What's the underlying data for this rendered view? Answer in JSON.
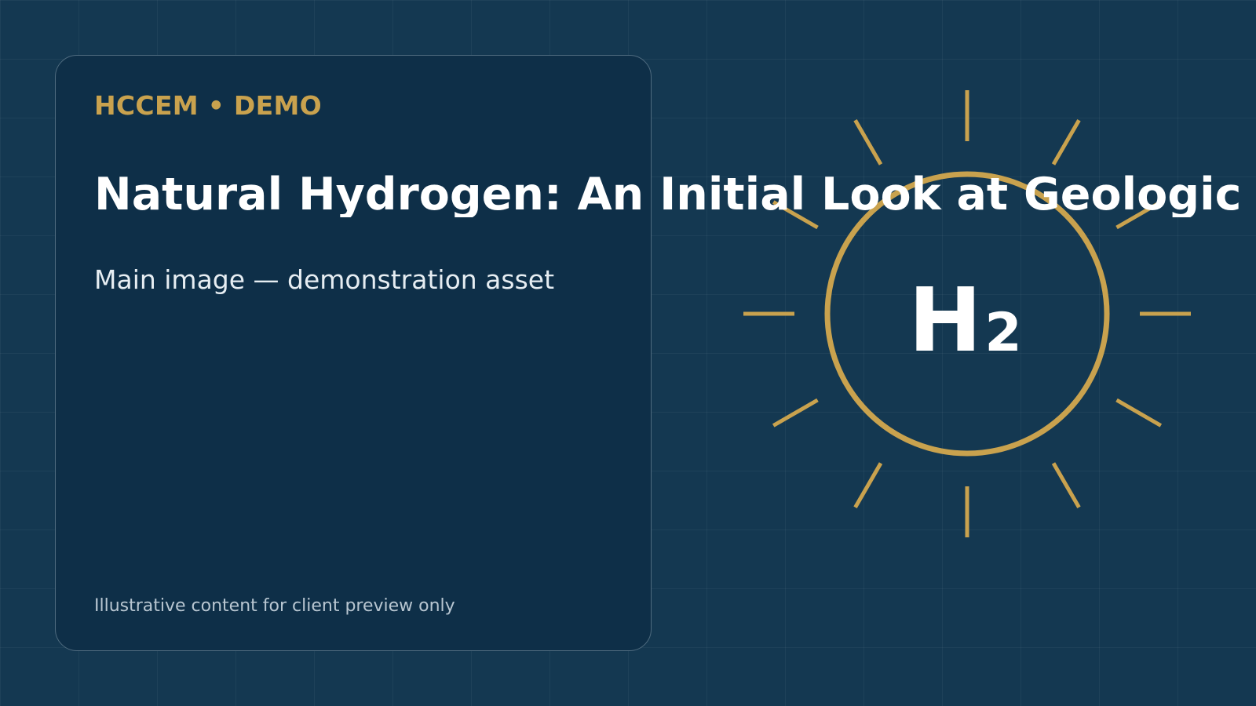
{
  "slide": {
    "eyebrow": "HCCEM • DEMO",
    "title": "Natural Hydrogen: An Initial Look at Geologic",
    "subtitle": "Main image — demonstration asset",
    "footnote": "Illustrative content for client preview only"
  },
  "emblem": {
    "symbol": "H",
    "subscript": "2",
    "icon": "hydrogen-sun-icon"
  },
  "colors": {
    "background": "#143851",
    "card": "#0e2f48",
    "accent": "#c9a24e",
    "text": "#ffffff"
  }
}
